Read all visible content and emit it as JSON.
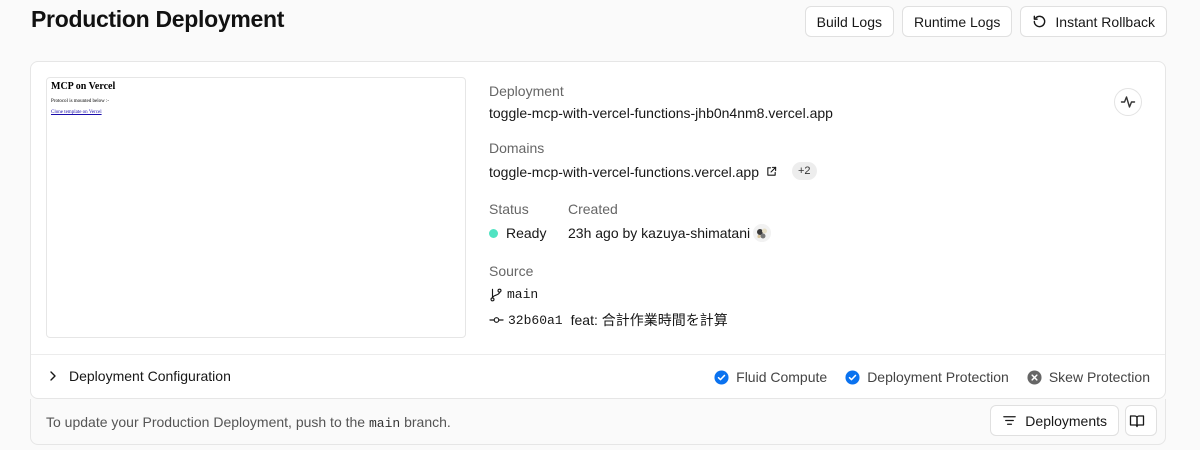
{
  "header": {
    "title": "Production Deployment",
    "build_logs": "Build Logs",
    "runtime_logs": "Runtime Logs",
    "instant_rollback": "Instant Rollback"
  },
  "preview": {
    "title": "MCP on Vercel",
    "text": "Protocol is mounted below :-",
    "link": "Clone template on Vercel"
  },
  "deployment": {
    "label": "Deployment",
    "url": "toggle-mcp-with-vercel-functions-jhb0n4nm8.vercel.app"
  },
  "domains": {
    "label": "Domains",
    "primary": "toggle-mcp-with-vercel-functions.vercel.app",
    "extra_count": "+2"
  },
  "status": {
    "label": "Status",
    "value": "Ready",
    "color": "#50e3c2"
  },
  "created": {
    "label": "Created",
    "value": "23h ago by kazuya-shimatani"
  },
  "source": {
    "label": "Source",
    "branch": "main",
    "commit_hash": "32b60a1",
    "commit_message": "feat: 合計作業時間を計算"
  },
  "config": {
    "label": "Deployment Configuration",
    "features": [
      {
        "label": "Fluid Compute",
        "state": "enabled",
        "icon": "check-circle-icon"
      },
      {
        "label": "Deployment Protection",
        "state": "enabled",
        "icon": "check-circle-icon"
      },
      {
        "label": "Skew Protection",
        "state": "disabled",
        "icon": "x-circle-icon"
      }
    ]
  },
  "footer": {
    "text_before": "To update your Production Deployment, push to the ",
    "branch": "main",
    "text_after": " branch.",
    "deployments_button": "Deployments"
  },
  "colors": {
    "accent_blue": "#0a72ef",
    "disabled_gray": "#666666"
  }
}
